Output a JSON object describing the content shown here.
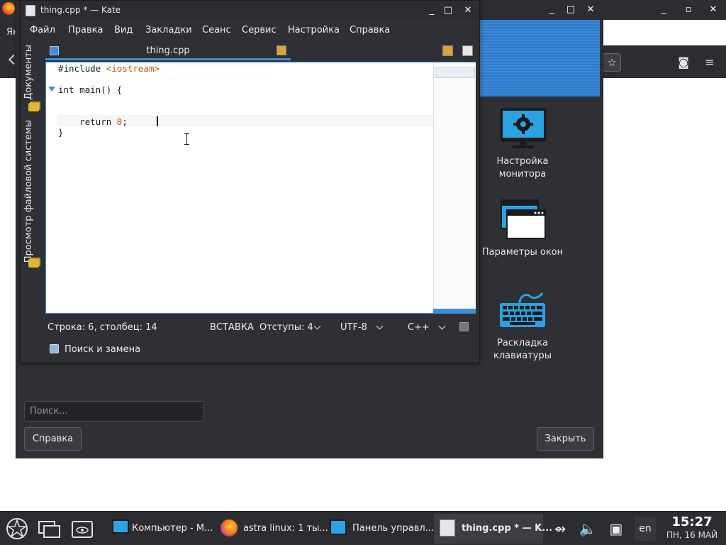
{
  "background_browser": {
    "menu_fragment": "Ян",
    "controls": {
      "minimize": "_",
      "maximize": "▫",
      "close": "✕"
    }
  },
  "control_panel": {
    "window_controls": {
      "minimize": "_",
      "maximize": "□",
      "close": "✕"
    },
    "icons": [
      {
        "label": "Настройка монитора",
        "icon": "monitor-settings-icon"
      },
      {
        "label": "Параметры окон",
        "icon": "window-settings-icon"
      },
      {
        "label": "Раскладка клавиатуры",
        "icon": "keyboard-layout-icon"
      }
    ],
    "search_placeholder": "Поиск...",
    "help_button": "Справка",
    "close_button": "Закрыть"
  },
  "kate": {
    "title": "thing.cpp * — Kate",
    "window_controls": {
      "minimize": "_",
      "maximize": "□",
      "close": "✕"
    },
    "menu": [
      "Файл",
      "Правка",
      "Вид",
      "Закладки",
      "Сеанс",
      "Сервис",
      "Настройка",
      "Справка"
    ],
    "side_tabs": [
      "Документы",
      "Просмотр файловой системы"
    ],
    "tab_label": "thing.cpp",
    "code": {
      "line1_directive": "#include ",
      "line1_header": "<iostream>",
      "line2": "int main() {",
      "line4_keyword": "    return ",
      "line4_value": "0",
      "line4_end": ";",
      "line5": "}"
    },
    "status": {
      "position": "Строка: 6, столбец: 14",
      "mode": "ВСТАВКА",
      "indent": "Отступы: 4",
      "encoding": "UTF-8",
      "syntax": "C++"
    },
    "search_panel": "Поиск и замена"
  },
  "taskbar": {
    "tasks": [
      {
        "label": "Компьютер - М...",
        "icon": "computer-icon"
      },
      {
        "label": "astra linux: 1 ты...",
        "icon": "firefox-icon"
      },
      {
        "label": "Панель управл...",
        "icon": "control-panel-icon"
      },
      {
        "label": "thing.cpp * — K...",
        "icon": "kate-icon"
      }
    ],
    "language": "en",
    "time": "15:27",
    "date": "ПН, 16 МАЙ"
  },
  "colors": {
    "accent": "#3d8fd6",
    "panel_bg": "#2f3035",
    "taskbar_bg": "#2b2d31"
  }
}
